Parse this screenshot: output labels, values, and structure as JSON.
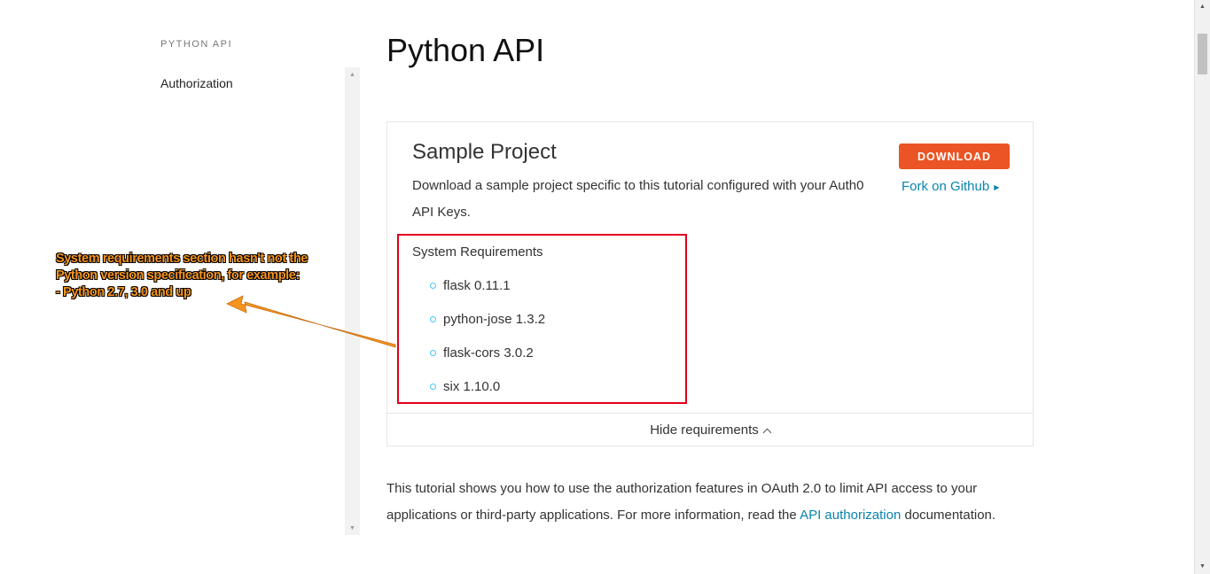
{
  "sidebar": {
    "heading": "PYTHON API",
    "items": [
      {
        "label": "Authorization"
      }
    ]
  },
  "main": {
    "title": "Python API",
    "sample_project": {
      "title": "Sample Project",
      "description": "Download a sample project specific to this tutorial configured with your Auth0 API Keys.",
      "download_label": "DOWNLOAD",
      "fork_label": "Fork on Github",
      "requirements_heading": "System Requirements",
      "requirements": [
        {
          "label": "flask 0.11.1"
        },
        {
          "label": "python-jose 1.3.2"
        },
        {
          "label": "flask-cors 3.0.2"
        },
        {
          "label": "six 1.10.0"
        }
      ],
      "toggle_label": "Hide requirements"
    },
    "intro": {
      "text_before": "This tutorial shows you how to use the authorization features in OAuth 2.0 to limit API access to your applications or third-party applications. For more information, read the ",
      "link_label": "API authorization",
      "text_after": " documentation."
    }
  },
  "annotation": {
    "text": "System requirements section hasn't not the\nPython version specification, for example:\n- Python 2.7, 3.0 and up"
  },
  "colors": {
    "accent": "#eb5424",
    "link": "#0a84ae",
    "bullet": "#44c7f4",
    "highlight": "#e3001b",
    "annotation": "#f7941d"
  },
  "icons": {
    "fork_caret": "triangle-right-icon",
    "toggle": "chevron-up-icon"
  }
}
